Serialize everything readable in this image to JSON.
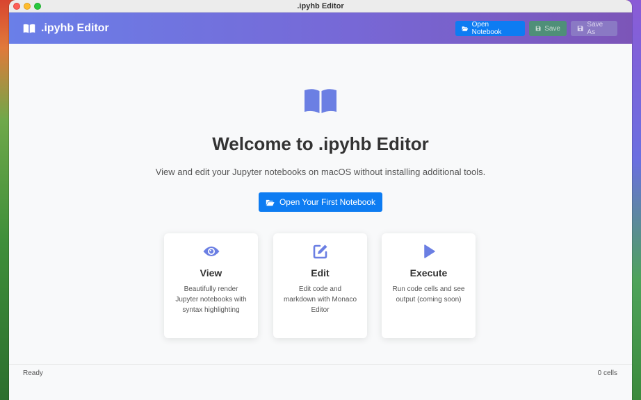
{
  "window": {
    "title": ".ipyhb Editor"
  },
  "app": {
    "name": ".ipyhb Editor"
  },
  "toolbar": {
    "open_label": "Open Notebook",
    "save_label": "Save",
    "save_as_label": "Save As"
  },
  "welcome": {
    "title": "Welcome to .ipyhb Editor",
    "subtitle": "View and edit your Jupyter notebooks on macOS without installing additional tools.",
    "cta_label": "Open Your First Notebook"
  },
  "features": [
    {
      "title": "View",
      "description": "Beautifully render Jupyter notebooks with syntax highlighting",
      "icon": "eye-icon"
    },
    {
      "title": "Edit",
      "description": "Edit code and markdown with Monaco Editor",
      "icon": "edit-icon"
    },
    {
      "title": "Execute",
      "description": "Run code cells and see output (coming soon)",
      "icon": "play-icon"
    }
  ],
  "status": {
    "left": "Ready",
    "right": "0 cells"
  },
  "colors": {
    "accent": "#0d7cf2",
    "icon": "#6b7fe3",
    "header_start": "#6a7fe8",
    "header_end": "#7c55b8"
  }
}
